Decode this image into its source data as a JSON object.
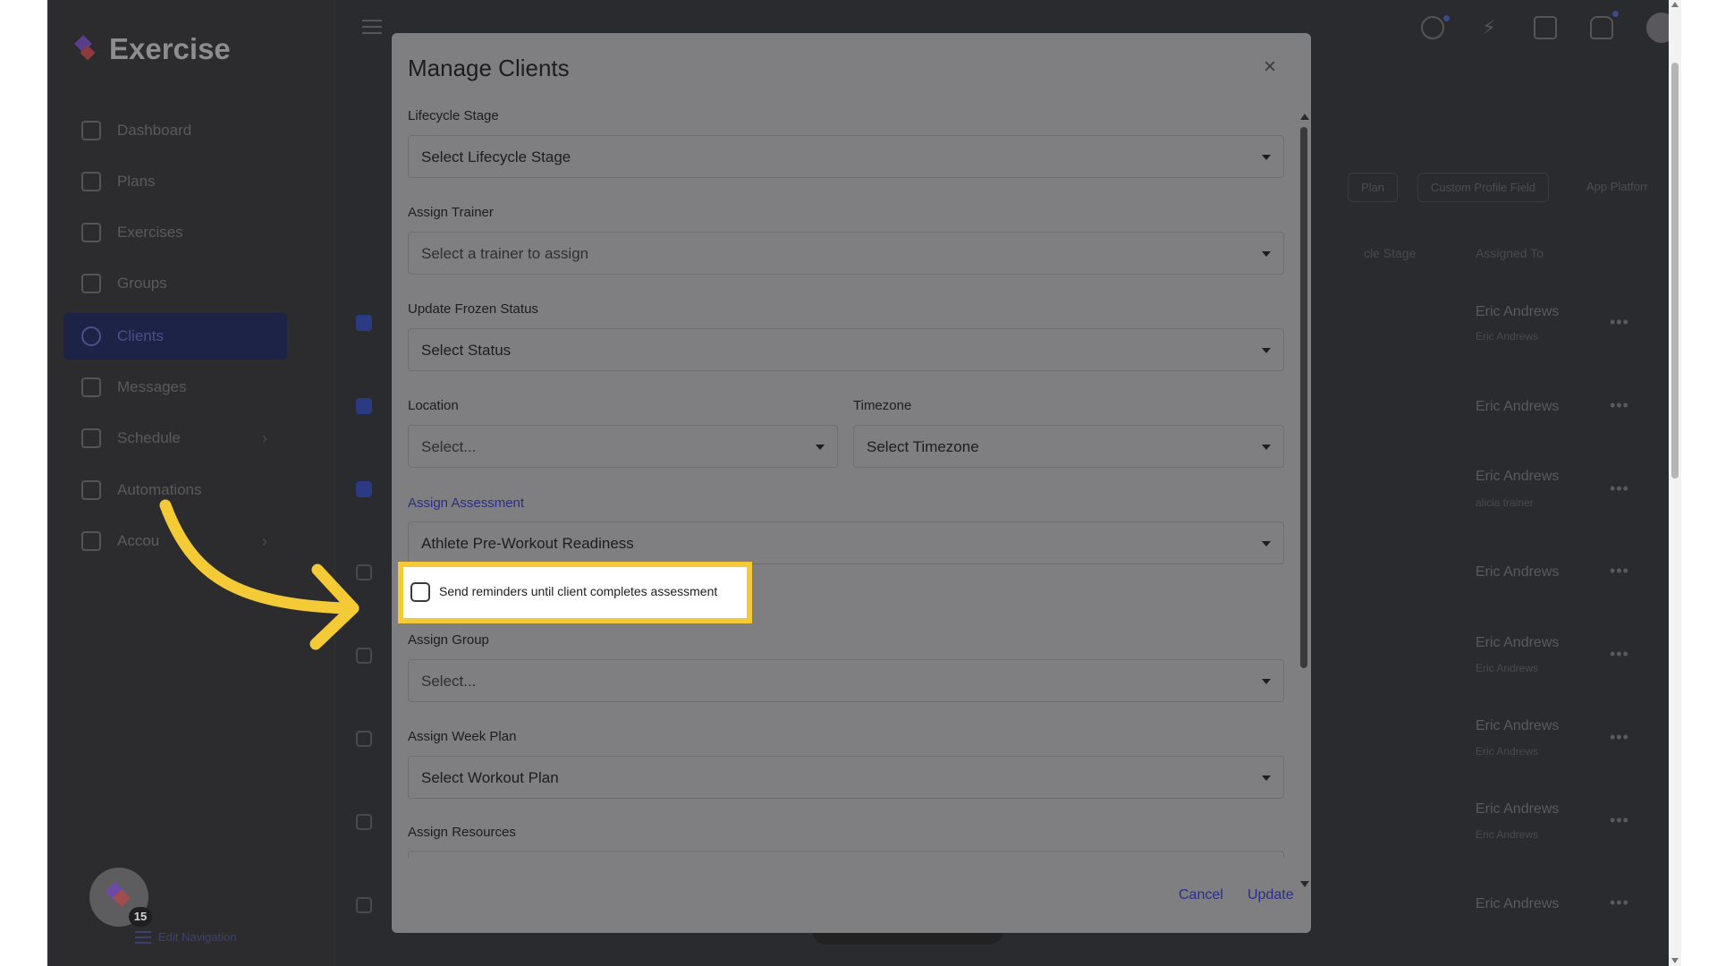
{
  "app": {
    "name": "Exercise"
  },
  "sidebar": {
    "items": [
      {
        "label": "Dashboard",
        "icon": "home-icon"
      },
      {
        "label": "Plans",
        "icon": "clipboard-icon"
      },
      {
        "label": "Exercises",
        "icon": "dumbbell-icon"
      },
      {
        "label": "Groups",
        "icon": "users-icon"
      },
      {
        "label": "Clients",
        "icon": "user-icon",
        "active": true
      },
      {
        "label": "Messages",
        "icon": "mail-icon"
      },
      {
        "label": "Schedule",
        "icon": "calendar-icon",
        "chevron": "›"
      },
      {
        "label": "Automations",
        "icon": "check-square-icon"
      },
      {
        "label": "Accou",
        "icon": "gear-icon",
        "chevron": "›"
      }
    ],
    "helper_count": "15",
    "edit_nav_label": "Edit Navigation"
  },
  "background": {
    "filters": [
      "Plan",
      "Custom Profile Field",
      "App Platforr"
    ],
    "columns": [
      "cle Stage",
      "Assigned To"
    ],
    "rows": [
      {
        "assigned": "Eric Andrews",
        "sub": "Eric Andrews"
      },
      {
        "assigned": "Eric Andrews",
        "sub": ""
      },
      {
        "assigned": "Eric Andrews",
        "sub": "alicia trainer"
      },
      {
        "assigned": "Eric Andrews",
        "sub": ""
      },
      {
        "assigned": "Eric Andrews",
        "sub": "Eric Andrews"
      },
      {
        "assigned": "Eric Andrews",
        "sub": "Eric Andrews"
      },
      {
        "assigned": "Eric Andrews",
        "sub": "Eric Andrews"
      },
      {
        "assigned": "Eric Andrews",
        "sub": ""
      }
    ],
    "row_menu": "•••"
  },
  "modal": {
    "title": "Manage Clients",
    "close": "×",
    "fields": {
      "lifecycle": {
        "label": "Lifecycle Stage",
        "value": "Select Lifecycle Stage"
      },
      "trainer": {
        "label": "Assign Trainer",
        "value": "Select a trainer to assign"
      },
      "frozen": {
        "label": "Update Frozen Status",
        "value": "Select Status"
      },
      "location": {
        "label": "Location",
        "value": "Select..."
      },
      "timezone": {
        "label": "Timezone",
        "value": "Select Timezone"
      },
      "assessment": {
        "label": "Assign Assessment",
        "value": "Athlete Pre-Workout Readiness"
      },
      "reminder": {
        "label": "Send reminders until client completes assessment",
        "checked": false
      },
      "group": {
        "label": "Assign Group",
        "value": "Select..."
      },
      "week_plan": {
        "label": "Assign Week Plan",
        "value": "Select Workout Plan"
      },
      "resources": {
        "label": "Assign Resources"
      }
    },
    "cancel": "Cancel",
    "update": "Update"
  },
  "colors": {
    "highlight": "#f4cb37",
    "accent": "#2a2e86",
    "overlay": "#2a2b2e"
  }
}
